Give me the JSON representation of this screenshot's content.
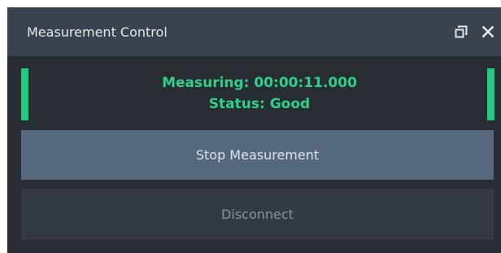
{
  "window": {
    "title": "Measurement Control",
    "float_icon": "float-window-icon",
    "close_icon": "close-icon"
  },
  "status": {
    "measuring_text": "Measuring: 00:00:11.000",
    "status_text": "Status: Good",
    "indicator_color": "#22c97e"
  },
  "buttons": {
    "stop_label": "Stop Measurement",
    "disconnect_label": "Disconnect"
  },
  "colors": {
    "titlebar": "#39424e",
    "panel": "#282d33",
    "stop_button": "#56687e",
    "disconnect_button": "#333a42",
    "status_text": "#2fd18a"
  }
}
